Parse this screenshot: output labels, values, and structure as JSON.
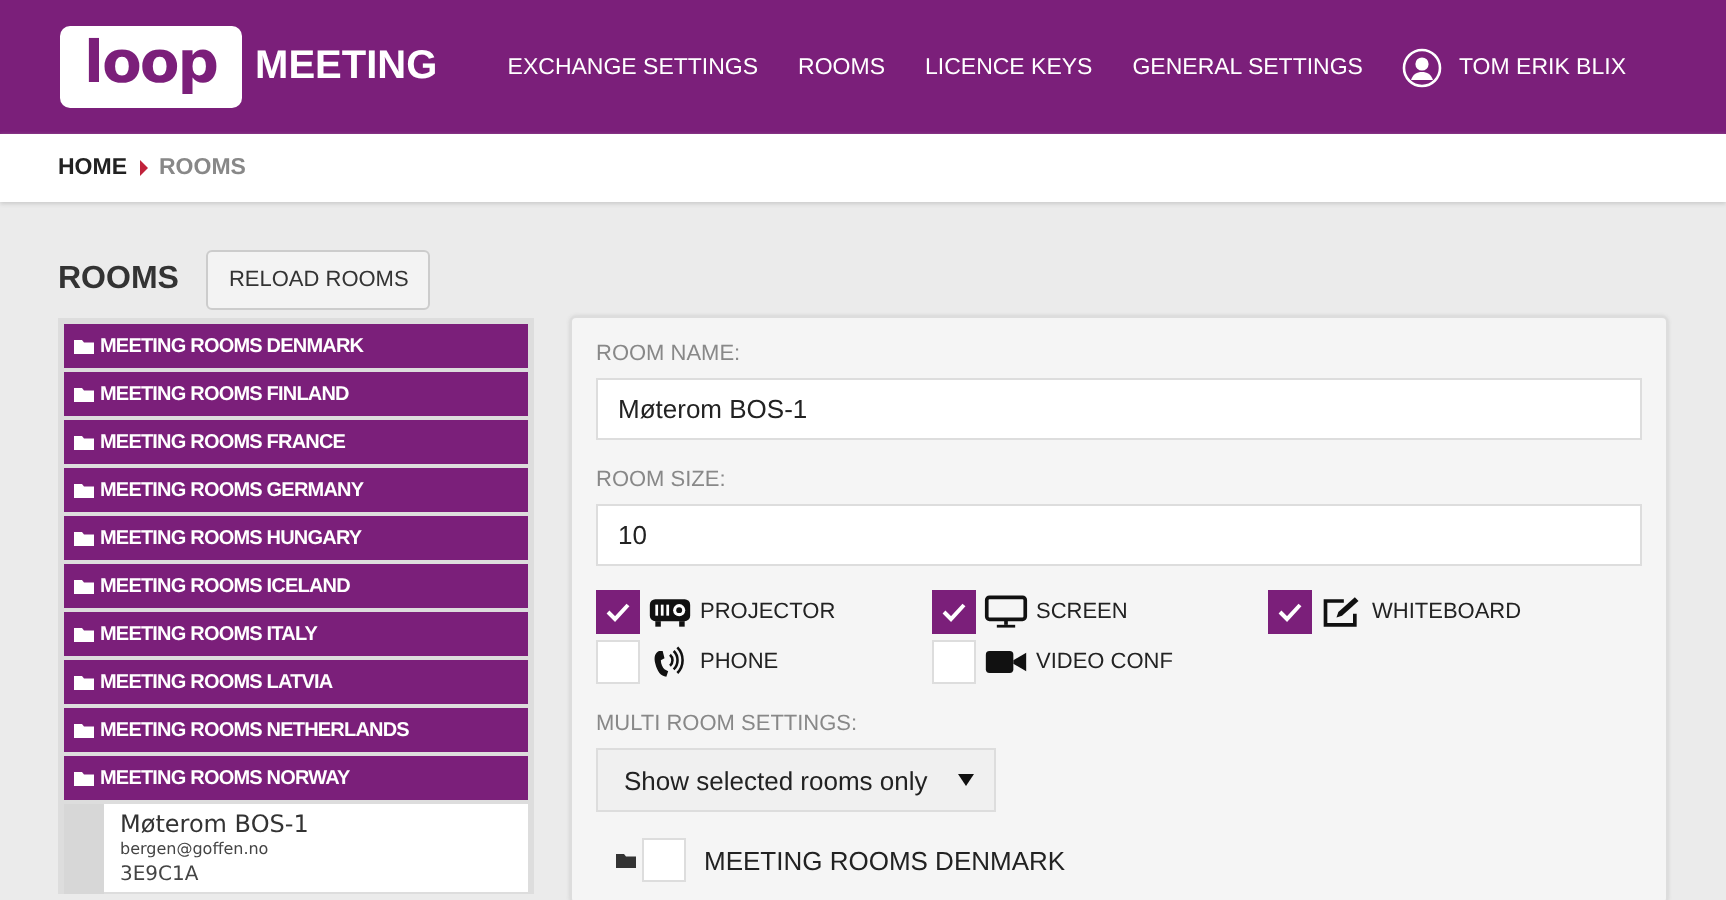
{
  "header": {
    "logo_word": "loop",
    "logo_brand": "MEETING",
    "nav": [
      {
        "label": "EXCHANGE SETTINGS"
      },
      {
        "label": "ROOMS"
      },
      {
        "label": "LICENCE KEYS"
      },
      {
        "label": "GENERAL SETTINGS"
      }
    ],
    "user": "TOM ERIK BLIX"
  },
  "breadcrumb": [
    "HOME",
    "ROOMS"
  ],
  "rooms_title": "ROOMS",
  "reload_button": "RELOAD ROOMS",
  "groups": [
    {
      "name": "MEETING ROOMS DENMARK"
    },
    {
      "name": "MEETING ROOMS FINLAND"
    },
    {
      "name": "MEETING ROOMS FRANCE"
    },
    {
      "name": "MEETING ROOMS GERMANY"
    },
    {
      "name": "MEETING ROOMS HUNGARY"
    },
    {
      "name": "MEETING ROOMS ICELAND"
    },
    {
      "name": "MEETING ROOMS ITALY"
    },
    {
      "name": "MEETING ROOMS LATVIA"
    },
    {
      "name": "MEETING ROOMS NETHERLANDS"
    },
    {
      "name": "MEETING ROOMS NORWAY",
      "rooms": [
        {
          "name": "Møterom BOS-1",
          "email": "bergen@goffen.no",
          "code": "3E9C1A"
        }
      ]
    }
  ],
  "form": {
    "room_name_label": "ROOM NAME:",
    "room_name": "Møterom BOS-1",
    "room_size_label": "ROOM SIZE:",
    "room_size": "10",
    "equipment": [
      {
        "kind": "projector",
        "label": "PROJECTOR",
        "checked": true
      },
      {
        "kind": "screen",
        "label": "SCREEN",
        "checked": true
      },
      {
        "kind": "whiteboard",
        "label": "WHITEBOARD",
        "checked": true
      },
      {
        "kind": "phone",
        "label": "PHONE",
        "checked": false
      },
      {
        "kind": "video",
        "label": "VIDEO CONF",
        "checked": false
      }
    ],
    "multi_label": "MULTI ROOM SETTINGS:",
    "multi_value": "Show selected rooms only",
    "multi_groups": [
      {
        "name": "MEETING ROOMS DENMARK",
        "checked": false
      }
    ]
  }
}
